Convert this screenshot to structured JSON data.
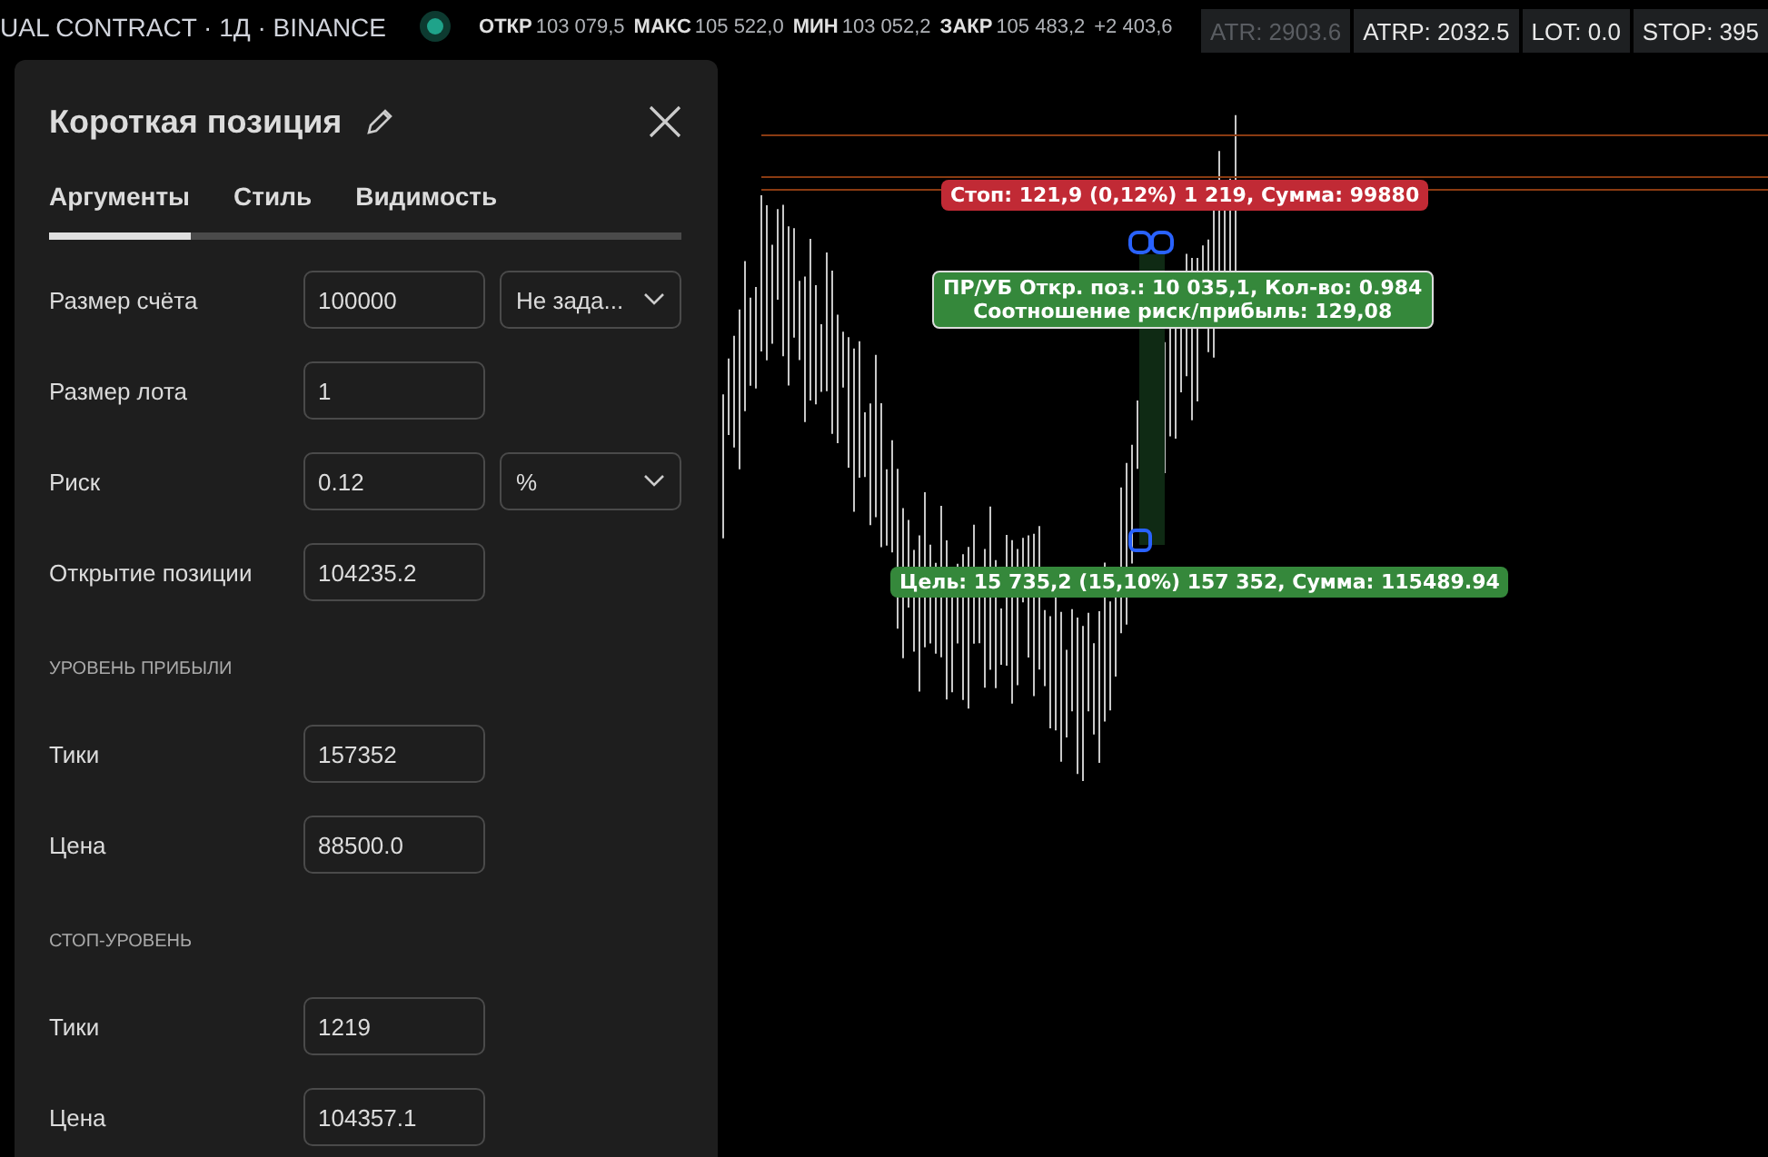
{
  "header": {
    "symbol": "UAL CONTRACT · 1Д · BINANCE",
    "ohlc": [
      {
        "label": "ОТКР",
        "value": "103 079,5"
      },
      {
        "label": "МАКС",
        "value": "105 522,0"
      },
      {
        "label": "МИН",
        "value": "103 052,2"
      },
      {
        "label": "ЗАКР",
        "value": "105 483,2"
      }
    ],
    "change": "+2 403,6",
    "indicators": [
      {
        "text": "ATR: 2903.6",
        "dimmed": true
      },
      {
        "text": "ATRP: 2032.5",
        "dimmed": false
      },
      {
        "text": "LOT: 0.0",
        "dimmed": false
      },
      {
        "text": "STOP: 395",
        "dimmed": false
      }
    ]
  },
  "chart": {
    "labels": [
      {
        "kind": "stop",
        "lines": [
          "Стоп: 121,9 (0,12%) 1 219, Сумма: 99880"
        ]
      },
      {
        "kind": "info",
        "lines": [
          "ПР/УБ Откр. поз.: 10 035,1, Кол-во: 0.984",
          "Соотношение риск/прибыль: 129,08"
        ]
      },
      {
        "kind": "target",
        "lines": [
          "Цель: 15 735,2 (15,10%) 157 352, Сумма: 115489.94"
        ]
      }
    ]
  },
  "panel": {
    "title": "Короткая позиция",
    "tabs": [
      {
        "label": "Аргументы",
        "selected": true
      },
      {
        "label": "Стиль",
        "selected": false
      },
      {
        "label": "Видимость",
        "selected": false
      }
    ],
    "rows": [
      {
        "kind": "field",
        "label": "Размер счёта",
        "value": "100000",
        "dropdown": "Не зада..."
      },
      {
        "kind": "field",
        "label": "Размер лота",
        "value": "1"
      },
      {
        "kind": "field",
        "label": "Риск",
        "value": "0.12",
        "dropdown": "%"
      },
      {
        "kind": "field",
        "label": "Открытие позиции",
        "value": "104235.2"
      },
      {
        "kind": "section",
        "label": "УРОВЕНЬ ПРИБЫЛИ"
      },
      {
        "kind": "field",
        "label": "Тики",
        "value": "157352"
      },
      {
        "kind": "field",
        "label": "Цена",
        "value": "88500.0"
      },
      {
        "kind": "section",
        "label": "СТОП-УРОВЕНЬ"
      },
      {
        "kind": "field",
        "label": "Тики",
        "value": "1219"
      },
      {
        "kind": "field",
        "label": "Цена",
        "value": "104357.1"
      }
    ]
  }
}
